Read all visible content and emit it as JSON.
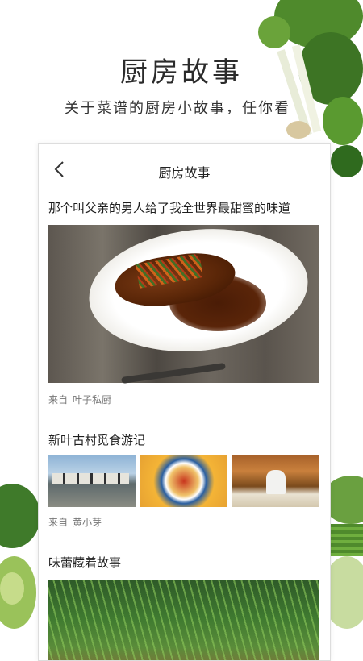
{
  "hero": {
    "title": "厨房故事",
    "subtitle": "关于菜谱的厨房小故事，任你看"
  },
  "card": {
    "header": {
      "title": "厨房故事",
      "back_icon": "chevron-left-icon"
    },
    "stories": [
      {
        "title": "那个叫父亲的男人给了我全世界最甜蜜的味道",
        "source_prefix": "来自",
        "source_name": "叶子私厨"
      },
      {
        "title": "新叶古村觅食游记",
        "source_prefix": "来自",
        "source_name": "黄小芽"
      },
      {
        "title": "味蕾藏着故事"
      }
    ]
  },
  "colors": {
    "background": "#ffffff",
    "card_border": "#dddddd",
    "source_text": "#777777"
  }
}
